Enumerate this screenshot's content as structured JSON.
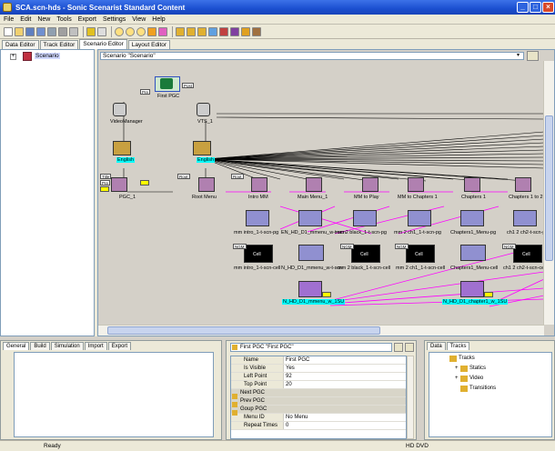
{
  "window": {
    "title": "SCA.scn-hds - Sonic Scenarist Standard Content",
    "min": "_",
    "max": "□",
    "close": "×"
  },
  "menu": [
    "File",
    "Edit",
    "New",
    "Tools",
    "Export",
    "Settings",
    "View",
    "Help"
  ],
  "tabs": [
    {
      "label": "Data Editor"
    },
    {
      "label": "Track Editor"
    },
    {
      "label": "Scenario Editor"
    },
    {
      "label": "Layout Editor"
    }
  ],
  "tree": {
    "expander": "+",
    "root": "Scenario"
  },
  "canvas": {
    "header": "Scenario \"Scenario\"",
    "nodes": [
      {
        "label": "First PGC",
        "pins": [
          "Pre",
          "Post"
        ]
      },
      {
        "label": "VideoManager"
      },
      {
        "label": "VTS_1"
      },
      {
        "label": "English"
      },
      {
        "label": "English"
      },
      {
        "label": "PGC_1",
        "pins": [
          "Title",
          "Pre"
        ]
      },
      {
        "label": "Root Menu",
        "pins": [
          "Root"
        ]
      },
      {
        "label": "Intro MM",
        "pins": [
          "Root"
        ]
      },
      {
        "label": "Main Menu_1"
      },
      {
        "label": "MM to Play"
      },
      {
        "label": "MM to Chapters 1"
      },
      {
        "label": "Chapters 1"
      },
      {
        "label": "Chapters 1 to 2"
      }
    ],
    "pg_row": [
      "mm intro_1-t-scn-pg",
      "EN_HD_D1_mmenu_w-t-scn",
      "mm 2 black_1-t-scn-pg",
      "mm 2 ch1_1-t-scn-pg",
      "Chapters1_Menu-pg",
      "ch1 2 ch2-t-scn-p"
    ],
    "cell_row": [
      "mm intro_1-t-scn-cell",
      "N_HD_D1_mmenu_w-t-scn",
      "mm 2 black_1-t-scn-cell",
      "mm 2 ch1_1-t-scn-cell",
      "Chapters1_Menu-cell",
      "ch1 2 ch2-t-scn-cell"
    ],
    "cell_text": "Cell",
    "ngm": "NGM",
    "subs": [
      "N_HD_D1_mmenu_w_1SU",
      "N_HD_D1_chapter1_w_1SU"
    ]
  },
  "bottom_left_tabs": [
    "General",
    "Build",
    "Simulation",
    "Import",
    "Export"
  ],
  "properties": {
    "header": "First PGC \"First PGC\"",
    "rows": [
      {
        "k": "Name",
        "v": "First PGC"
      },
      {
        "k": "Is Visible",
        "v": "Yes"
      },
      {
        "k": "Left Point",
        "v": "92"
      },
      {
        "k": "Top Point",
        "v": "20"
      },
      {
        "k": "Next PGC",
        "v": "",
        "group": true
      },
      {
        "k": "Prev PGC",
        "v": "",
        "group": true
      },
      {
        "k": "Goup PGC",
        "v": "",
        "group": true
      },
      {
        "k": "Menu ID",
        "v": "No Menu"
      },
      {
        "k": "Repeat Times",
        "v": "0"
      }
    ]
  },
  "right_tabs": [
    "Data",
    "Tracks"
  ],
  "tracks_tree": {
    "root": "Tracks",
    "children": [
      "Statics",
      "Video",
      "Transitions"
    ]
  },
  "status": {
    "left": "Ready",
    "right": "HD DVD"
  },
  "colors": {
    "titlebar": "#1b4fd0",
    "link_magenta": "#ff00ff",
    "label_cyan": "#00ffff"
  }
}
